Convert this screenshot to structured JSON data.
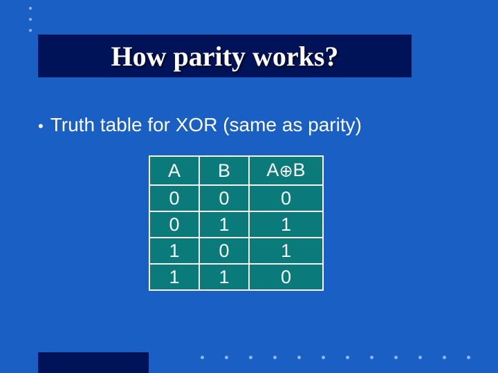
{
  "title": "How parity works?",
  "bullet": "Truth table for XOR (same as parity)",
  "chart_data": {
    "type": "table",
    "columns": [
      "A",
      "B",
      "A⊕B"
    ],
    "rows": [
      [
        "0",
        "0",
        "0"
      ],
      [
        "0",
        "1",
        "1"
      ],
      [
        "1",
        "0",
        "1"
      ],
      [
        "1",
        "1",
        "0"
      ]
    ]
  }
}
